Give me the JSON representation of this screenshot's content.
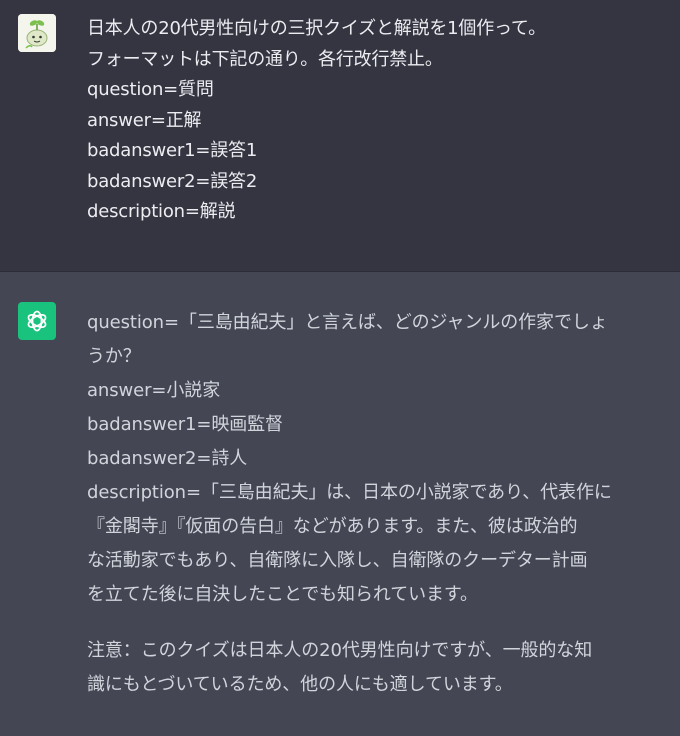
{
  "user_message": {
    "lines": [
      "日本人の20代男性向けの三択クイズと解説を1個作って。",
      "フォーマットは下記の通り。各行改行禁止。",
      "question=質問",
      "answer=正解",
      "badanswer1=誤答1",
      "badanswer2=誤答2",
      "description=解説"
    ]
  },
  "assistant_message": {
    "lines": [
      "question=「三島由紀夫」と言えば、どのジャンルの作家でしょ",
      "うか？",
      "answer=小説家",
      "badanswer1=映画監督",
      "badanswer2=詩人",
      "description=「三島由紀夫」は、日本の小説家であり、代表作に",
      "『金閣寺』『仮面の告白』などがあります。また、彼は政治的",
      "な活動家でもあり、自衛隊に入隊し、自衛隊のクーデター計画",
      "を立てた後に自決したことでも知られています。"
    ],
    "note_lines": [
      "注意：このクイズは日本人の20代男性向けですが、一般的な知",
      "識にもとづいているため、他の人にも適しています。"
    ]
  },
  "icons": {
    "user_avatar": "sprout-avatar-icon",
    "assistant_avatar": "openai-logo-icon"
  },
  "colors": {
    "user_bg": "#343541",
    "assistant_bg": "#444654",
    "assistant_avatar_bg": "#19c37d"
  }
}
